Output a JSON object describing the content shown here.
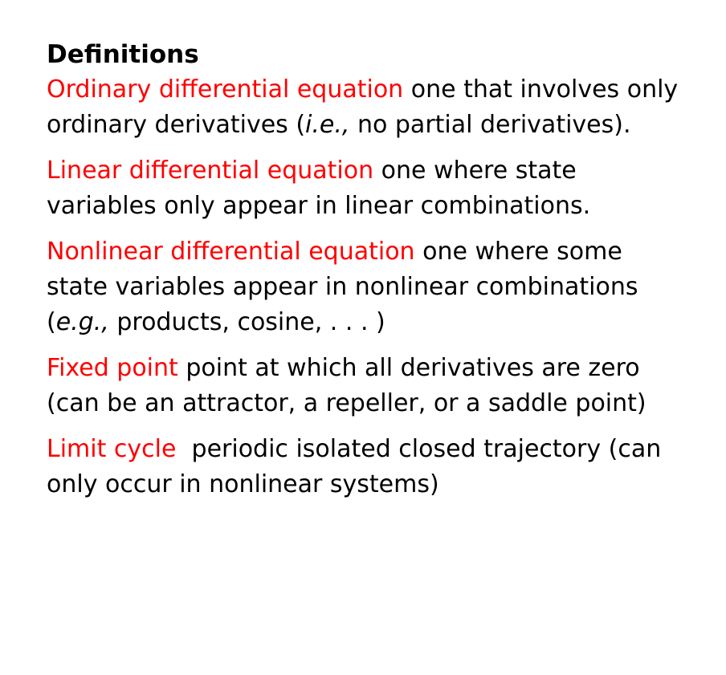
{
  "heading": "Definitions",
  "colors": {
    "term": "#ff0000",
    "text": "#000000",
    "background": "#ffffff"
  },
  "definitions": [
    {
      "term": "Ordinary differential equation",
      "before": " one that involves only ordinary derivatives (",
      "emph": "i.e.,",
      "after": " no partial derivatives)."
    },
    {
      "term": "Linear differential equation",
      "before": " one where state variables only appear in linear combinations."
    },
    {
      "term": "Nonlinear differential equation",
      "before": " one where some state variables appear in nonlinear combinations (",
      "emph": "e.g.,",
      "after": " products, cosine, . . . )"
    },
    {
      "term": "Fixed point",
      "before": " point at which all derivatives are zero (can be an attractor, a repeller, or a saddle point)"
    },
    {
      "term": "Limit cycle",
      "before": "  periodic isolated closed trajectory (can only occur in nonlinear systems)"
    }
  ]
}
